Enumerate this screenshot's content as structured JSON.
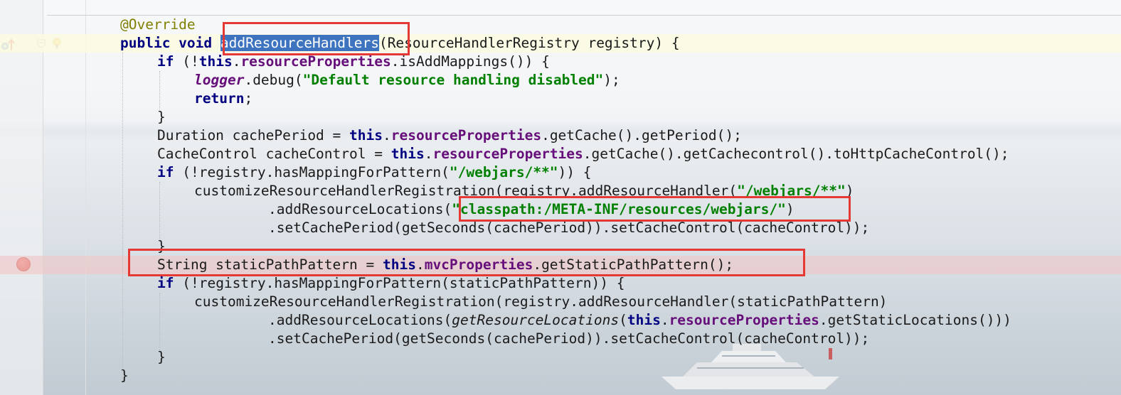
{
  "editor": {
    "lines": [
      {
        "segments": [
          {
            "t": "@Override",
            "c": "ann"
          }
        ]
      },
      {
        "segments": [
          {
            "t": "public void ",
            "c": "kw"
          },
          {
            "t": "addResourceHandlers",
            "c": "sel"
          },
          {
            "t": "(ResourceHandlerRegistry registry) {",
            "c": ""
          }
        ]
      },
      {
        "segments": [
          {
            "t": "if ",
            "c": "kw"
          },
          {
            "t": "(!",
            "c": ""
          },
          {
            "t": "this",
            "c": "kw"
          },
          {
            "t": ".",
            "c": ""
          },
          {
            "t": "resourceProperties",
            "c": "fld"
          },
          {
            "t": ".isAddMappings()) {",
            "c": ""
          }
        ]
      },
      {
        "segments": [
          {
            "t": "logger",
            "c": "fld ital"
          },
          {
            "t": ".debug(",
            "c": ""
          },
          {
            "t": "\"Default resource handling disabled\"",
            "c": "str"
          },
          {
            "t": ");",
            "c": ""
          }
        ]
      },
      {
        "segments": [
          {
            "t": "return",
            "c": "kw"
          },
          {
            "t": ";",
            "c": ""
          }
        ]
      },
      {
        "segments": [
          {
            "t": "}",
            "c": ""
          }
        ]
      },
      {
        "segments": [
          {
            "t": "Duration cachePeriod = ",
            "c": ""
          },
          {
            "t": "this",
            "c": "kw"
          },
          {
            "t": ".",
            "c": ""
          },
          {
            "t": "resourceProperties",
            "c": "fld"
          },
          {
            "t": ".getCache().getPeriod();",
            "c": ""
          }
        ]
      },
      {
        "segments": [
          {
            "t": "CacheControl cacheControl = ",
            "c": ""
          },
          {
            "t": "this",
            "c": "kw"
          },
          {
            "t": ".",
            "c": ""
          },
          {
            "t": "resourceProperties",
            "c": "fld"
          },
          {
            "t": ".getCache().getCachecontrol().toHttpCacheControl();",
            "c": ""
          }
        ]
      },
      {
        "segments": [
          {
            "t": "if ",
            "c": "kw"
          },
          {
            "t": "(!registry.hasMappingForPattern(",
            "c": ""
          },
          {
            "t": "\"/webjars/**\"",
            "c": "str"
          },
          {
            "t": ")) {",
            "c": ""
          }
        ]
      },
      {
        "segments": [
          {
            "t": "customizeResourceHandlerRegistration(registry.addResourceHandler(",
            "c": ""
          },
          {
            "t": "\"/webjars/**\"",
            "c": "str"
          },
          {
            "t": ")",
            "c": ""
          }
        ]
      },
      {
        "segments": [
          {
            "t": ".addResourceLocations(",
            "c": ""
          },
          {
            "t": "\"classpath:/META-INF/resources/webjars/\"",
            "c": "str"
          },
          {
            "t": ")",
            "c": ""
          }
        ]
      },
      {
        "segments": [
          {
            "t": ".setCachePeriod(getSeconds(cachePeriod)).setCacheControl(cacheControl));",
            "c": ""
          }
        ]
      },
      {
        "segments": [
          {
            "t": "}",
            "c": ""
          }
        ]
      },
      {
        "segments": [
          {
            "t": "String staticPathPattern = ",
            "c": ""
          },
          {
            "t": "this",
            "c": "kw"
          },
          {
            "t": ".",
            "c": ""
          },
          {
            "t": "mvcProperties",
            "c": "fld"
          },
          {
            "t": ".getStaticPathPattern();",
            "c": ""
          }
        ]
      },
      {
        "segments": [
          {
            "t": "if ",
            "c": "kw"
          },
          {
            "t": "(!registry.hasMappingForPattern(staticPathPattern)) {",
            "c": ""
          }
        ]
      },
      {
        "segments": [
          {
            "t": "customizeResourceHandlerRegistration(registry.addResourceHandler(staticPathPattern)",
            "c": ""
          }
        ]
      },
      {
        "segments": [
          {
            "t": ".addResourceLocations(",
            "c": ""
          },
          {
            "t": "getResourceLocations",
            "c": "ital"
          },
          {
            "t": "(",
            "c": ""
          },
          {
            "t": "this",
            "c": "kw"
          },
          {
            "t": ".",
            "c": ""
          },
          {
            "t": "resourceProperties",
            "c": "fld"
          },
          {
            "t": ".getStaticLocations()))",
            "c": ""
          }
        ]
      },
      {
        "segments": [
          {
            "t": ".setCachePeriod(getSeconds(cachePeriod)).setCacheControl(cacheControl));",
            "c": ""
          }
        ]
      },
      {
        "segments": [
          {
            "t": "}",
            "c": ""
          }
        ]
      },
      {
        "segments": [
          {
            "t": "}",
            "c": ""
          }
        ]
      }
    ]
  },
  "gutter": {
    "override_icon": "override-method-icon",
    "fold_icon": "fold-icon",
    "bulb_icon": "intention-bulb-icon",
    "breakpoint_icon": "breakpoint-icon"
  },
  "colors": {
    "keyword": "#000080",
    "field": "#660e7a",
    "string": "#008000",
    "annotation": "#808000",
    "selection": "#3d73bf",
    "highlight_box": "#e53935",
    "breakpoint": "#d8423a"
  }
}
